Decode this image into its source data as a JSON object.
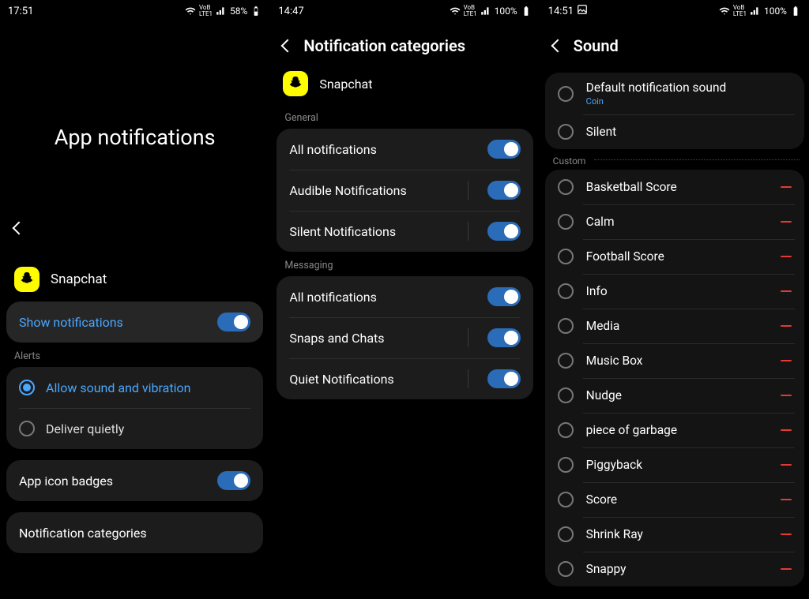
{
  "panel1": {
    "status": {
      "time": "17:51",
      "battery": "58%"
    },
    "title": "App notifications",
    "app_name": "Snapchat",
    "show_notifications": "Show notifications",
    "alerts_label": "Alerts",
    "allow_sound": "Allow sound and vibration",
    "deliver_quietly": "Deliver quietly",
    "app_icon_badges": "App icon badges",
    "notification_categories": "Notification categories"
  },
  "panel2": {
    "status": {
      "time": "14:47",
      "battery": "100%"
    },
    "title": "Notification categories",
    "app_name": "Snapchat",
    "general_label": "General",
    "general": [
      {
        "label": "All notifications",
        "divider": false
      },
      {
        "label": "Audible Notifications",
        "divider": true
      },
      {
        "label": "Silent Notifications",
        "divider": true
      }
    ],
    "messaging_label": "Messaging",
    "messaging": [
      {
        "label": "All notifications",
        "divider": false
      },
      {
        "label": "Snaps and Chats",
        "divider": true
      },
      {
        "label": "Quiet Notifications",
        "divider": true
      }
    ]
  },
  "panel3": {
    "status": {
      "time": "14:51",
      "battery": "100%"
    },
    "title": "Sound",
    "default_label": "Default notification sound",
    "default_sub": "Coin",
    "silent": "Silent",
    "custom_label": "Custom",
    "custom": [
      "Basketball Score",
      "Calm",
      "Football Score",
      "Info",
      "Media",
      "Music Box",
      "Nudge",
      "piece of garbage",
      "Piggyback",
      "Score",
      "Shrink Ray",
      "Snappy"
    ]
  }
}
